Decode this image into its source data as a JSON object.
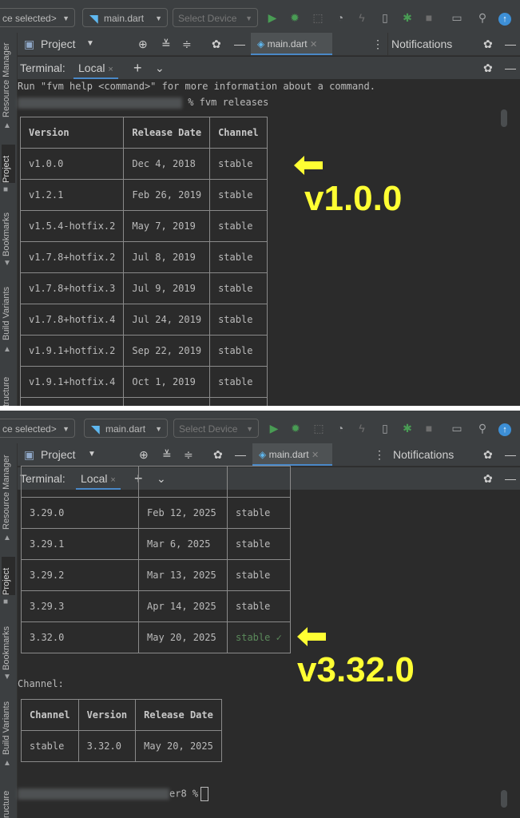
{
  "toolbar": {
    "device_selector": "ce selected>",
    "file_selector": "main.dart",
    "device_dropdown": "Select Device",
    "run_icon": "play-icon",
    "debug_icon": "bug-icon",
    "search_icon": "search-icon",
    "update_icon": "update-icon"
  },
  "project_row": {
    "project_label": "Project",
    "editor_tab": "main.dart",
    "notifications_label": "Notifications"
  },
  "terminal_header": {
    "title": "Terminal:",
    "local_tab": "Local",
    "close": "×",
    "add": "+",
    "expand": "⌄"
  },
  "side_labels": {
    "resource_manager": "Resource Manager",
    "project": "Project",
    "bookmarks": "Bookmarks",
    "build_variants": "Build Variants",
    "structure": "tructure"
  },
  "panel1": {
    "help_line": "Run \"fvm help <command>\" for more information about a command.",
    "prompt_cmd": "% fvm releases",
    "headers": [
      "Version",
      "Release Date",
      "Channel"
    ],
    "rows": [
      [
        "v1.0.0",
        "Dec 4, 2018",
        "stable"
      ],
      [
        "v1.2.1",
        "Feb 26, 2019",
        "stable"
      ],
      [
        "v1.5.4-hotfix.2",
        "May 7, 2019",
        "stable"
      ],
      [
        "v1.7.8+hotfix.2",
        "Jul 8, 2019",
        "stable"
      ],
      [
        "v1.7.8+hotfix.3",
        "Jul 9, 2019",
        "stable"
      ],
      [
        "v1.7.8+hotfix.4",
        "Jul 24, 2019",
        "stable"
      ],
      [
        "v1.9.1+hotfix.2",
        "Sep 22, 2019",
        "stable"
      ],
      [
        "v1.9.1+hotfix.4",
        "Oct 1, 2019",
        "stable"
      ]
    ],
    "annotation": "v1.0.0"
  },
  "panel2": {
    "rows": [
      [
        "3.29.0",
        "Feb 12, 2025",
        "stable"
      ],
      [
        "3.29.1",
        "Mar 6, 2025",
        "stable"
      ],
      [
        "3.29.2",
        "Mar 13, 2025",
        "stable"
      ],
      [
        "3.29.3",
        "Apr 14, 2025",
        "stable"
      ],
      [
        "3.32.0",
        "May 20, 2025",
        "stable ✓"
      ]
    ],
    "channel_label": "Channel:",
    "channel_headers": [
      "Channel",
      "Version",
      "Release Date"
    ],
    "channel_row": [
      "stable",
      "3.32.0",
      "May 20, 2025"
    ],
    "prompt_tail": "er8 %",
    "annotation": "v3.32.0"
  },
  "colors": {
    "background": "#2b2b2b",
    "chrome": "#3c3f41",
    "annotation": "#ffff33",
    "run_green": "#499c54",
    "accent_blue": "#4a88c7"
  }
}
